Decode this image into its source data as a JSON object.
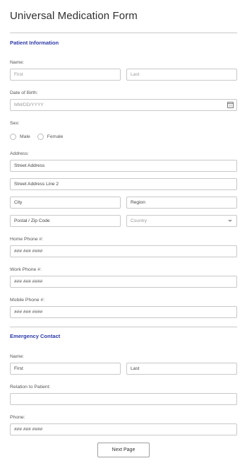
{
  "form": {
    "title": "Universal Medication Form",
    "next_button_label": "Next Page"
  },
  "patient": {
    "section_title": "Patient Information",
    "name_label": "Name:",
    "first_placeholder": "First",
    "last_placeholder": "Last",
    "dob_label": "Date of Birth:",
    "dob_placeholder": "MM/DD/YYYY",
    "sex_label": "Sex:",
    "sex_options": [
      "Male",
      "Female"
    ],
    "address_label": "Address:",
    "street_placeholder": "Street Address",
    "street2_placeholder": "Street Address Line 2",
    "city_placeholder": "City",
    "region_placeholder": "Region",
    "postal_placeholder": "Postal / Zip Code",
    "country_placeholder": "Country",
    "home_phone_label": "Home Phone #:",
    "home_phone_placeholder": "### ### ####",
    "work_phone_label": "Work Phone #:",
    "work_phone_placeholder": "### ### ####",
    "mobile_phone_label": "Mobile Phone #:",
    "mobile_phone_placeholder": "### ### ####"
  },
  "emergency": {
    "section_title": "Emergency Contact",
    "name_label": "Name:",
    "first_placeholder": "First",
    "last_placeholder": "Last",
    "relation_label": "Relation to Patient:",
    "relation_value": "",
    "phone_label": "Phone:",
    "phone_placeholder": "### ### ####"
  },
  "icons": {
    "date_picker": "calendar-icon",
    "country_dropdown": "chevron-down-icon"
  }
}
